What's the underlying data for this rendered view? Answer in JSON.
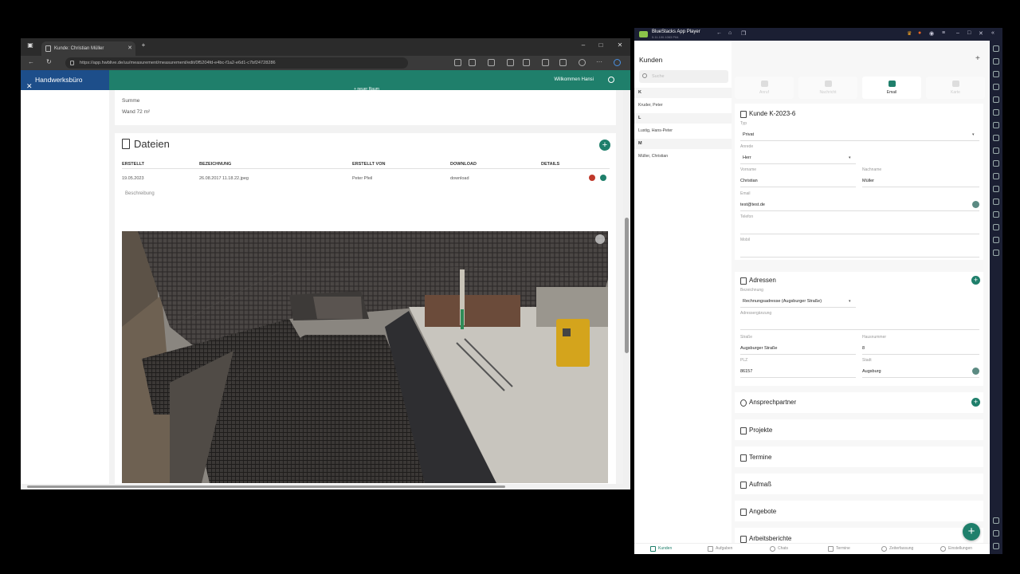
{
  "browser": {
    "tab_title": "Kunde: Christian Müller",
    "url": "https://app.hwblive.de/uu/measurement/measurement/edit/0f5204fd-e4bc-f1a2-e6d1-c7bf24728286",
    "app_name": "Handwerksbüro",
    "welcome": "Willkommen Hansi",
    "raum_button": "+ neuer Raum",
    "summe_label": "Summe",
    "wand_text": "Wand  72 m²",
    "dateien_title": "Dateien",
    "table": {
      "headers": [
        "ERSTELLT",
        "BEZEICHNUNG",
        "ERSTELLT VON",
        "DOWNLOAD",
        "DETAILS"
      ],
      "row": [
        "19.05.2023",
        "26.08.2017 11.18.22.jpeg",
        "Peter Pfeil",
        "download"
      ]
    },
    "beschreibung": "Beschreibung",
    "colors": {
      "header": "#1f7f6b",
      "brand": "#1d4e8a"
    }
  },
  "bluestacks": {
    "title": "BlueStacks App Player",
    "version": "5.11.100.1063 P64",
    "kunden_title": "Kunden",
    "search_placeholder": "Suche",
    "groups": [
      {
        "letter": "K",
        "customers": [
          "Kruder, Peter"
        ]
      },
      {
        "letter": "L",
        "customers": [
          "Lustig, Hans-Peter"
        ]
      },
      {
        "letter": "M",
        "customers": [
          "Müller, Christian"
        ]
      }
    ],
    "action_tabs": [
      "Anruf",
      "Nachricht",
      "Email",
      "Karte"
    ],
    "customer": {
      "title": "Kunde K-2023-6",
      "typ_label": "Typ",
      "typ_value": "Privat",
      "anrede_label": "Anrede",
      "anrede_value": "Herr",
      "vorname_label": "Vorname",
      "vorname_value": "Christian",
      "nachname_label": "Nachname",
      "nachname_value": "Müller",
      "email_label": "Email",
      "email_value": "test@test.de",
      "telefon_label": "Telefon",
      "mobil_label": "Mobil"
    },
    "adressen": {
      "title": "Adressen",
      "bezeichnung_label": "Bezeichnung",
      "bezeichnung_value": "Rechnungsadresse (Augsburger Straße)",
      "zusatz_label": "Adressergänzung",
      "strasse_label": "Straße",
      "strasse_value": "Augsburger Straße",
      "hausnummer_label": "Hausnummer",
      "hausnummer_value": "8",
      "plz_label": "PLZ",
      "plz_value": "86157",
      "stadt_label": "Stadt",
      "stadt_value": "Augsburg"
    },
    "sections": [
      "Ansprechpartner",
      "Projekte",
      "Termine",
      "Aufmaß",
      "Angebote",
      "Arbeitsberichte"
    ],
    "bottom_nav": [
      "Kunden",
      "Aufgaben",
      "Chats",
      "Termine",
      "Zeiterfassung",
      "Einstellungen"
    ]
  }
}
